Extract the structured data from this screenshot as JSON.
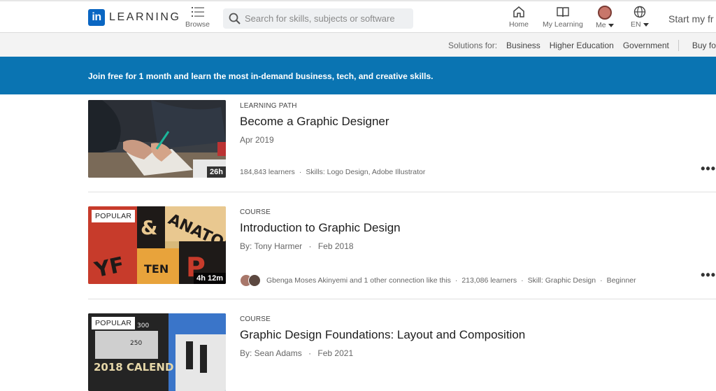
{
  "nav": {
    "logo_text": "LEARNING",
    "browse_label": "Browse",
    "search_placeholder": "Search for skills, subjects or software",
    "home_label": "Home",
    "my_learning_label": "My Learning",
    "me_label": "Me",
    "language_label": "EN",
    "start_free_label": "Start my fr"
  },
  "solutions": {
    "label": "Solutions for:",
    "links": [
      "Business",
      "Higher Education",
      "Government",
      "Buy fo"
    ]
  },
  "banner": {
    "text": "Join free for 1 month and learn the most in-demand business, tech, and creative skills."
  },
  "items": [
    {
      "kind": "LEARNING PATH",
      "title": "Become a Graphic Designer",
      "meta": [
        "Apr 2019"
      ],
      "duration": "26h",
      "foot": [
        "184,843 learners",
        "Skills: Logo Design, Adobe Illustrator"
      ]
    },
    {
      "kind": "COURSE",
      "title": "Introduction to Graphic Design",
      "meta": [
        "By: Tony Harmer",
        "Feb 2018"
      ],
      "duration": "4h 12m",
      "badge": "POPULAR",
      "foot": [
        "Gbenga Moses Akinyemi and 1 other connection like this",
        "213,086 learners",
        "Skill: Graphic Design",
        "Beginner"
      ]
    },
    {
      "kind": "COURSE",
      "title": "Graphic Design Foundations: Layout and Composition",
      "meta": [
        "By: Sean Adams",
        "Feb 2021"
      ],
      "badge": "POPULAR"
    }
  ],
  "more_glyph": "•••",
  "colors": {
    "brand": "#0a66c2",
    "banner": "#0a74b2"
  }
}
